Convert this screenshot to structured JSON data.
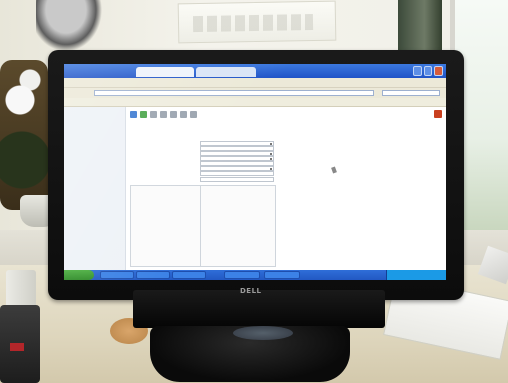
{
  "scene": {
    "monitor_brand": "DELL"
  },
  "screen": {
    "browser": {
      "tabs": [
        "",
        ""
      ],
      "menu": "",
      "bookmarks": ""
    },
    "app": {
      "sidebar_head": "",
      "sidebar_items": [
        "",
        "",
        ""
      ],
      "page_title": "",
      "subnav": "",
      "right_info": [
        "",
        ""
      ],
      "form_rows": 9
    },
    "taskbar": {
      "start_label": ""
    }
  }
}
